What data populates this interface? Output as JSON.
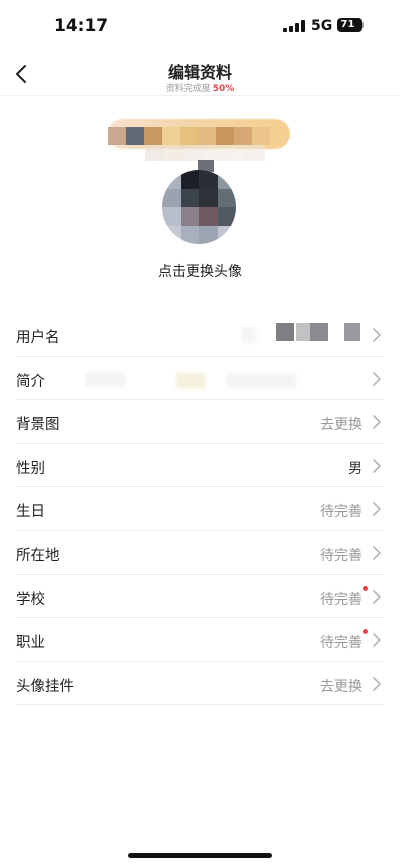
{
  "status_bar": {
    "time": "14:17",
    "network": "5G",
    "battery": "71"
  },
  "nav": {
    "back_icon": "chevron-left-icon",
    "title": "编辑资料",
    "completeness_label": "资料完成度",
    "completeness_value": "50%"
  },
  "avatar": {
    "caption": "点击更换头像"
  },
  "profile_rows": [
    {
      "label": "用户名",
      "value": ""
    },
    {
      "label": "简介",
      "value": ""
    },
    {
      "label": "背景图",
      "value": "去更换"
    },
    {
      "label": "性别",
      "value": "男"
    },
    {
      "label": "生日",
      "value": "待完善"
    },
    {
      "label": "所在地",
      "value": "待完善"
    },
    {
      "label": "学校",
      "value": "待完善"
    },
    {
      "label": "职业",
      "value": "待完善"
    },
    {
      "label": "头像挂件",
      "value": "去更换"
    }
  ],
  "colors": {
    "accent_red": "#e8434a",
    "secondary_text": "#999999",
    "divider": "#efefef"
  }
}
